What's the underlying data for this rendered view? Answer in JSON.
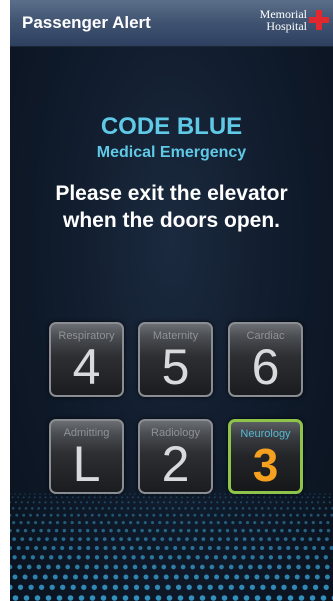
{
  "header": {
    "title": "Passenger Alert",
    "logo_line1": "Memorial",
    "logo_line2": "Hospital",
    "logo_icon": "red-cross-icon"
  },
  "alert": {
    "code": "CODE BLUE",
    "type": "Medical Emergency",
    "message_line1": "Please exit the elevator",
    "message_line2": "when the doors open."
  },
  "floors": [
    {
      "label": "Respiratory",
      "number": "4"
    },
    {
      "label": "Maternity",
      "number": "5"
    },
    {
      "label": "Cardiac",
      "number": "6"
    },
    {
      "label": "Admitting",
      "number": "L"
    },
    {
      "label": "Radiology",
      "number": "2"
    },
    {
      "label": "Neurology",
      "number": "3"
    }
  ],
  "active_floor": "3",
  "colors": {
    "accent_blue": "#5fc9e6",
    "active_border": "#8fc44a",
    "active_number": "#f5a11f",
    "cross_red": "#e0282e"
  }
}
